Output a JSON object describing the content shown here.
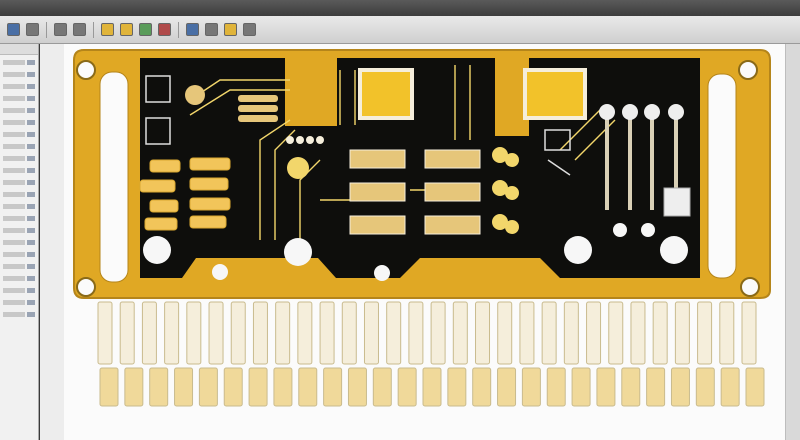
{
  "app": {
    "toolbar_buttons": [
      "file-open",
      "save",
      "undo",
      "redo",
      "zoom-in",
      "zoom-out",
      "layer",
      "route",
      "via",
      "drc",
      "settings",
      "3d-view"
    ],
    "sidebar_rows": 22
  },
  "board": {
    "substrate_color": "#e0a824",
    "solder_mask_color": "#0e0e0c",
    "copper_color": "#f2d66b",
    "pin_color": "#f5eedb",
    "pin_count_top": 30,
    "pin_count_bottom": 27
  }
}
